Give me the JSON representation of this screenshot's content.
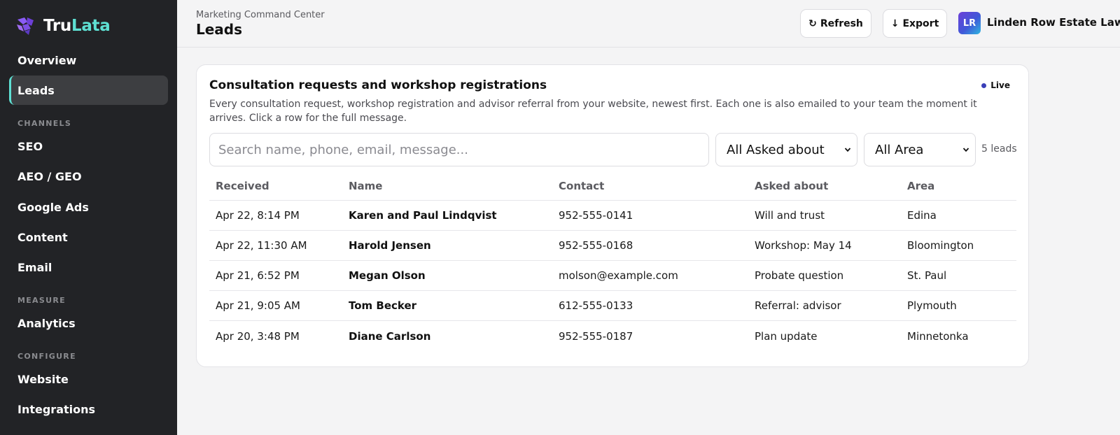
{
  "brand": {
    "name_part1": "Tru",
    "name_part2": "Lata",
    "accent": "#5ee0d3"
  },
  "sidebar": {
    "overview": "Overview",
    "leads": "Leads",
    "channels_heading": "CHANNELS",
    "seo": "SEO",
    "aeo": "AEO / GEO",
    "google_ads": "Google Ads",
    "content": "Content",
    "email": "Email",
    "measure_heading": "MEASURE",
    "analytics": "Analytics",
    "configure_heading": "CONFIGURE",
    "website": "Website",
    "integrations": "Integrations"
  },
  "header": {
    "breadcrumb": "Marketing Command Center",
    "title": "Leads",
    "refresh_label": "Refresh",
    "export_label": "Export",
    "avatar_initials": "LR",
    "org_name": "Linden Row Estate Law"
  },
  "card": {
    "title": "Consultation requests and workshop registrations",
    "live_label": "Live",
    "description": "Every consultation request, workshop registration and advisor referral from your website, newest first. Each one is also emailed to your team the moment it arrives. Click a row for the full message.",
    "search_placeholder": "Search name, phone, email, message...",
    "filter_asked": "All Asked about",
    "filter_area": "All Area",
    "count_label": "5 leads"
  },
  "table": {
    "headers": {
      "received": "Received",
      "name": "Name",
      "contact": "Contact",
      "asked": "Asked about",
      "area": "Area"
    },
    "rows": [
      {
        "received": "Apr 22, 8:14 PM",
        "name": "Karen and Paul Lindqvist",
        "contact": "952-555-0141",
        "asked": "Will and trust",
        "area": "Edina"
      },
      {
        "received": "Apr 22, 11:30 AM",
        "name": "Harold Jensen",
        "contact": "952-555-0168",
        "asked": "Workshop: May 14",
        "area": "Bloomington"
      },
      {
        "received": "Apr 21, 6:52 PM",
        "name": "Megan Olson",
        "contact": "molson@example.com",
        "asked": "Probate question",
        "area": "St. Paul"
      },
      {
        "received": "Apr 21, 9:05 AM",
        "name": "Tom Becker",
        "contact": "612-555-0133",
        "asked": "Referral: advisor",
        "area": "Plymouth"
      },
      {
        "received": "Apr 20, 3:48 PM",
        "name": "Diane Carlson",
        "contact": "952-555-0187",
        "asked": "Plan update",
        "area": "Minnetonka"
      }
    ]
  }
}
